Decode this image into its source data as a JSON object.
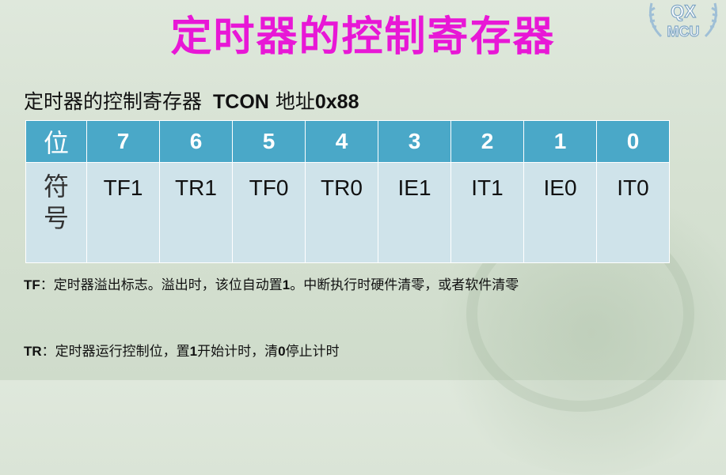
{
  "logo": {
    "top_text": "QX",
    "bottom_text": "MCU"
  },
  "title": "定时器的控制寄存器",
  "subtitle": {
    "cn": "定时器的控制寄存器",
    "en": "TCON",
    "addr_label": "地址",
    "addr_value": "0x88"
  },
  "table": {
    "header_label": "位",
    "bits": [
      "7",
      "6",
      "5",
      "4",
      "3",
      "2",
      "1",
      "0"
    ],
    "row_label_line1": "符",
    "row_label_line2": "号",
    "symbols": [
      "TF1",
      "TR1",
      "TF0",
      "TR0",
      "IE1",
      "IT1",
      "IE0",
      "IT0"
    ]
  },
  "notes": {
    "tf_term": "TF",
    "tf_text": "：定时器溢出标志。溢出时，该位自动置",
    "tf_one": "1",
    "tf_rest": "。中断执行时硬件清零，或者软件清零",
    "tr_term": "TR",
    "tr_text": "：定时器运行控制位，置",
    "tr_one": "1",
    "tr_mid": "开始计时，清",
    "tr_zero": "0",
    "tr_rest": "停止计时"
  },
  "colors": {
    "title": "#e817d6",
    "table_header": "#4aa8c8",
    "table_body": "#cfe3ea",
    "background": "#d6e1d2"
  }
}
